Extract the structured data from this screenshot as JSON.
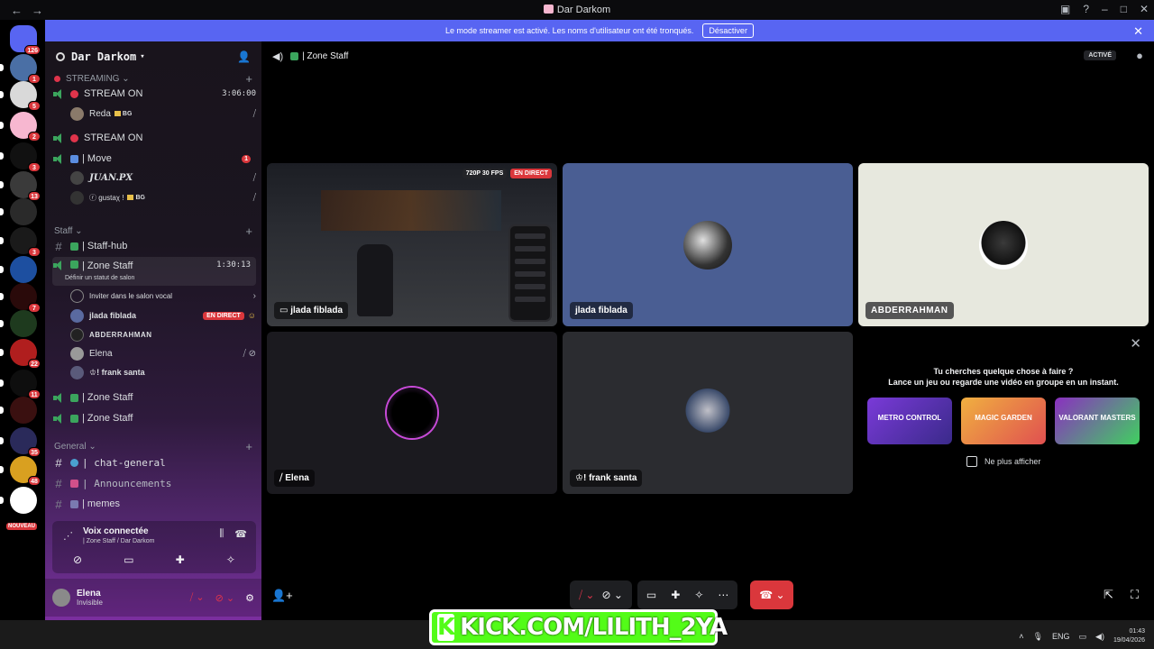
{
  "window": {
    "title": "Dar Darkom"
  },
  "servers": [
    {
      "badge": "126",
      "color": "#5865f2"
    },
    {
      "badge": "1",
      "color": "#4a6fa5"
    },
    {
      "badge": "5",
      "color": "#d9d9d9"
    },
    {
      "badge": "2",
      "color": "#f7b7d0"
    },
    {
      "badge": "3",
      "color": "#111111"
    },
    {
      "badge": "13",
      "color": "#3a3a3a"
    },
    {
      "badge": "",
      "color": "#2a2a2a"
    },
    {
      "badge": "3",
      "color": "#1a1a1a"
    },
    {
      "badge": "",
      "color": "#1d4fa0"
    },
    {
      "badge": "7",
      "color": "#2a0a0a"
    },
    {
      "badge": "",
      "color": "#1e3a1e"
    },
    {
      "badge": "22",
      "color": "#b01e1e"
    },
    {
      "badge": "11",
      "color": "#0e0e0e"
    },
    {
      "badge": "",
      "color": "#3a1010"
    },
    {
      "badge": "35",
      "color": "#2a2a5a"
    },
    {
      "badge": "48",
      "color": "#d9a020"
    },
    {
      "badge": "",
      "color": "#ffffff"
    }
  ],
  "nouveau": "NOUVEAU",
  "sidebar": {
    "guild_name": "Dar Darkom",
    "cat_streaming": "STREAMING",
    "ch_stream_on_1": "STREAM ON",
    "ch_stream_on_1_time": "3:06:00",
    "user_reda": "Reda",
    "tag_bg": "BG",
    "ch_stream_on_2": "STREAM ON",
    "ch_move": "| Move",
    "move_badge": "1",
    "user_juanpx": "JUAN.PX",
    "user_gustax": "ⓡ gustaχ !",
    "cat_staff": "Staff",
    "ch_staff_hub": "| Staff-hub",
    "ch_zone_staff": "| Zone Staff",
    "zone_staff_time": "1:30:13",
    "status_prompt": "Définir un statut de salon",
    "invite_label": "Inviter dans le salon vocal",
    "user_jlada": "jlada fiblada",
    "live_label": "EN DIRECT",
    "user_abderrahman": "ABDERRAHMAN",
    "user_elena": "Elena",
    "user_frank": "♔! frank santa",
    "ch_zone_staff_2": "| Zone Staff",
    "ch_zone_staff_3": "| Zone Staff",
    "cat_general": "General",
    "ch_chat_general": "| chat-general",
    "ch_announcements": "| Announcements",
    "ch_memes": "| memes"
  },
  "voice_panel": {
    "status": "Voix connectée",
    "location": "| Zone Staff / Dar Darkom"
  },
  "user_panel": {
    "name": "Elena",
    "status": "Invisible"
  },
  "banner": {
    "text": "Le mode streamer est activé. Les noms d'utilisateur ont été tronqués.",
    "button": "Désactiver"
  },
  "topbar": {
    "channel": "| Zone Staff",
    "activity": "ACTIVÉ"
  },
  "tiles": {
    "stream_user": "jlada fiblada",
    "quality": "720P 30 FPS",
    "live": "EN DIRECT",
    "jlada_label": "jlada fiblada",
    "abderrahman_label": "ABDERRAHMAN",
    "elena_label": "Elena",
    "frank_label": "♔! frank santa"
  },
  "suggest": {
    "line1": "Tu cherches quelque chose à faire ?",
    "line2": "Lance un jeu ou regarde une vidéo en groupe en un instant.",
    "games": [
      "METRO CONTROL",
      "MAGIC GARDEN",
      "VALORANT MASTERS"
    ],
    "checkbox": "Ne plus afficher"
  },
  "overlay": {
    "kick": "KICK.COM/LILITH_2YA"
  },
  "taskbar": {
    "lang": "ENG",
    "time": "01:43",
    "date": "19/04/2026"
  }
}
